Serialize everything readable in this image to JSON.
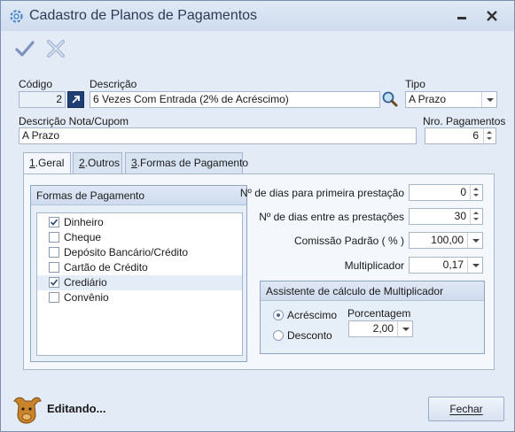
{
  "window": {
    "title": "Cadastro de Planos de Pagamentos"
  },
  "toolbar": {
    "confirm_icon": "check-icon",
    "cancel_icon": "x-icon"
  },
  "form": {
    "codigo_label": "Código",
    "codigo_value": "2",
    "descricao_label": "Descrição",
    "descricao_value": "6 Vezes Com Entrada (2% de Acréscimo)",
    "tipo_label": "Tipo",
    "tipo_value": "A Prazo",
    "descricao_nota_label": "Descrição Nota/Cupom",
    "descricao_nota_value": "A Prazo",
    "nro_pagamentos_label": "Nro. Pagamentos",
    "nro_pagamentos_value": "6"
  },
  "tabs": [
    {
      "key": "1",
      "label": ".Geral"
    },
    {
      "key": "2",
      "label": ".Outros"
    },
    {
      "key": "3",
      "label": ".Formas de Pagamento"
    }
  ],
  "formas": {
    "title": "Formas de Pagamento",
    "items": [
      {
        "label": "Dinheiro",
        "checked": true
      },
      {
        "label": "Cheque",
        "checked": false
      },
      {
        "label": "Depósito Bancário/Crédito",
        "checked": false
      },
      {
        "label": "Cartão de Crédito",
        "checked": false
      },
      {
        "label": "Crediário",
        "checked": true
      },
      {
        "label": "Convênio",
        "checked": false
      }
    ]
  },
  "right": {
    "primeira_label": "Nº de dias para primeira prestação",
    "primeira_value": "0",
    "entre_label": "Nº de dias entre as prestações",
    "entre_value": "30",
    "comissao_label": "Comissão Padrão ( % )",
    "comissao_value": "100,00",
    "multiplicador_label": "Multiplicador",
    "multiplicador_value": "0,17"
  },
  "assistente": {
    "title": "Assistente de cálculo de Multiplicador",
    "acrescimo_label": "Acréscimo",
    "desconto_label": "Desconto",
    "porcentagem_label": "Porcentagem",
    "porcentagem_value": "2,00",
    "selected": "Acréscimo"
  },
  "footer": {
    "status": "Editando...",
    "fechar_label": "Fechar"
  },
  "colors": {
    "accent": "#4f6a94",
    "background": "#e3ebf6"
  }
}
